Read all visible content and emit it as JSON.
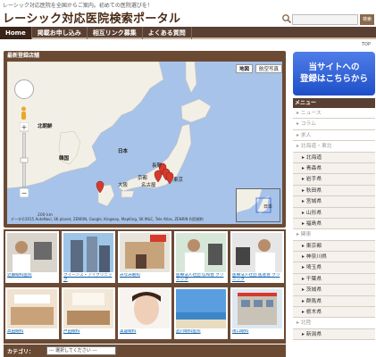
{
  "header": {
    "tagline": "レーシック対応医院を全国からご案内。初めての医院選びを！",
    "title": "レーシック対応医院検索ポータル",
    "search": {
      "placeholder": "",
      "button_label": "検索"
    }
  },
  "nav": {
    "items": [
      {
        "label": "Home",
        "active": true
      },
      {
        "label": "掲載お申し込み",
        "active": false
      },
      {
        "label": "相互リンク募集",
        "active": false
      },
      {
        "label": "よくある質問",
        "active": false
      }
    ],
    "top_link": "TOP"
  },
  "map_panel": {
    "title": "最新登録店舗",
    "map_buttons": {
      "map": "地図",
      "satellite": "航空写真"
    },
    "labels": {
      "ulsan": "北朝鮮",
      "korea": "韓国",
      "japan": "日本",
      "kyoto": "京都",
      "nagoya": "名古屋",
      "osaka": "大阪",
      "tokyo": "東京",
      "nagano": "長野"
    },
    "scale": "200 km",
    "footer": "データ©2015 AutoNavi, SK planet, ZENRIN, Google, Kingway, MapKing, SK M&C, Tele Atlas, ZENRIN  利用規約",
    "minimap_label": "日本",
    "marker_color": "#d63a2d"
  },
  "clinics": [
    {
      "caption": "近藤眼科医院"
    },
    {
      "caption": "クイーンズ・アイクリニック"
    },
    {
      "caption": "みなみ眼科"
    },
    {
      "caption": "医療法人社団 信和会 クリニック"
    },
    {
      "caption": "医療法人社団 医進会 クリニック"
    },
    {
      "caption": "高田眼科"
    },
    {
      "caption": "戸田眼科"
    },
    {
      "caption": "美容眼科"
    },
    {
      "caption": "品川眼科医院"
    },
    {
      "caption": "南口眼科"
    }
  ],
  "category": {
    "label": "カテゴリ：",
    "selected": "--- 選択してください ---"
  },
  "register_button": {
    "line1": "当サイトへの",
    "line2": "登録はこちらから"
  },
  "sidebar": {
    "header": "メニュー",
    "items": [
      {
        "label": "ニュース",
        "type": "cat"
      },
      {
        "label": "コラム",
        "type": "cat"
      },
      {
        "label": "求人",
        "type": "cat"
      },
      {
        "label": "北海道・東北",
        "type": "cat"
      },
      {
        "label": "北海道",
        "type": "sub"
      },
      {
        "label": "青森県",
        "type": "sub"
      },
      {
        "label": "岩手県",
        "type": "sub"
      },
      {
        "label": "秋田県",
        "type": "sub"
      },
      {
        "label": "宮城県",
        "type": "sub"
      },
      {
        "label": "山形県",
        "type": "sub"
      },
      {
        "label": "福島県",
        "type": "sub"
      },
      {
        "label": "関東",
        "type": "cat"
      },
      {
        "label": "東京都",
        "type": "sub"
      },
      {
        "label": "神奈川県",
        "type": "sub"
      },
      {
        "label": "埼玉県",
        "type": "sub"
      },
      {
        "label": "千葉県",
        "type": "sub"
      },
      {
        "label": "茨城県",
        "type": "sub"
      },
      {
        "label": "群馬県",
        "type": "sub"
      },
      {
        "label": "栃木県",
        "type": "sub"
      },
      {
        "label": "北陸",
        "type": "cat"
      },
      {
        "label": "新潟県",
        "type": "sub"
      }
    ]
  }
}
